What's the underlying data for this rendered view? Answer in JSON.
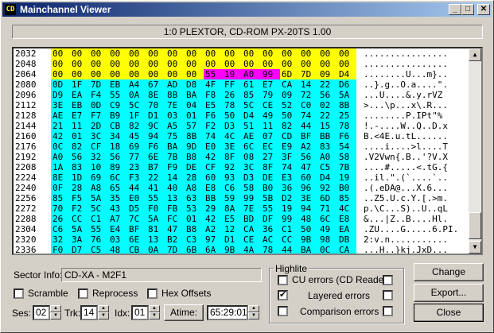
{
  "window": {
    "title": "Mainchannel Viewer",
    "icon_text": "CD",
    "min": "_",
    "max": "□",
    "close": "✕"
  },
  "drive": "1:0 PLEXTOR, CD-ROM PX-20TS 1.00",
  "hex_rows": [
    {
      "addr": "2032",
      "bytes": [
        "00",
        "00",
        "00",
        "00",
        "00",
        "00",
        "00",
        "00",
        "00",
        "00",
        "00",
        "00",
        "00",
        "00",
        "00",
        "00"
      ],
      "hl": [
        "y",
        "y",
        "y",
        "y",
        "y",
        "y",
        "y",
        "y",
        "y",
        "y",
        "y",
        "y",
        "y",
        "y",
        "y",
        "y"
      ],
      "ascii": "................"
    },
    {
      "addr": "2048",
      "bytes": [
        "00",
        "00",
        "00",
        "00",
        "00",
        "00",
        "00",
        "00",
        "00",
        "00",
        "00",
        "00",
        "00",
        "00",
        "00",
        "00"
      ],
      "hl": [
        "y",
        "y",
        "y",
        "y",
        "y",
        "y",
        "y",
        "y",
        "y",
        "y",
        "y",
        "y",
        "y",
        "y",
        "y",
        "y"
      ],
      "ascii": "................"
    },
    {
      "addr": "2064",
      "bytes": [
        "00",
        "00",
        "00",
        "00",
        "00",
        "00",
        "00",
        "00",
        "55",
        "19",
        "A0",
        "99",
        "6D",
        "7D",
        "09",
        "D4"
      ],
      "hl": [
        "y",
        "y",
        "y",
        "y",
        "y",
        "y",
        "y",
        "y",
        "m",
        "m",
        "m",
        "m",
        "y",
        "y",
        "y",
        "y"
      ],
      "ascii": "........U...m}.."
    },
    {
      "addr": "2080",
      "bytes": [
        "0D",
        "1F",
        "7D",
        "EB",
        "A4",
        "67",
        "AD",
        "D8",
        "4F",
        "FF",
        "61",
        "E7",
        "CA",
        "14",
        "22",
        "D6"
      ],
      "hl": [
        "c",
        "c",
        "c",
        "c",
        "c",
        "c",
        "c",
        "c",
        "c",
        "c",
        "c",
        "c",
        "c",
        "c",
        "c",
        "c"
      ],
      "ascii": "..}.g..O.a....\"."
    },
    {
      "addr": "2096",
      "bytes": [
        "D9",
        "EA",
        "F4",
        "55",
        "0A",
        "8E",
        "8B",
        "BA",
        "F8",
        "26",
        "85",
        "79",
        "09",
        "72",
        "56",
        "5A"
      ],
      "hl": [
        "c",
        "c",
        "c",
        "c",
        "c",
        "c",
        "c",
        "c",
        "c",
        "c",
        "c",
        "c",
        "c",
        "c",
        "c",
        "c"
      ],
      "ascii": "...U....&.y.rVZ"
    },
    {
      "addr": "2112",
      "bytes": [
        "3E",
        "EB",
        "0D",
        "C9",
        "5C",
        "70",
        "7E",
        "04",
        "E5",
        "78",
        "5C",
        "CE",
        "52",
        "C0",
        "02",
        "8B"
      ],
      "hl": [
        "c",
        "c",
        "c",
        "c",
        "c",
        "c",
        "c",
        "c",
        "c",
        "c",
        "c",
        "c",
        "c",
        "c",
        "c",
        "c"
      ],
      "ascii": ">...\\p...x\\.R..."
    },
    {
      "addr": "2128",
      "bytes": [
        "AE",
        "E7",
        "F7",
        "B9",
        "1F",
        "D1",
        "03",
        "01",
        "F6",
        "50",
        "D4",
        "49",
        "50",
        "74",
        "22",
        "25"
      ],
      "hl": [
        "c",
        "c",
        "c",
        "c",
        "c",
        "c",
        "c",
        "c",
        "c",
        "c",
        "c",
        "c",
        "c",
        "c",
        "c",
        "c"
      ],
      "ascii": "........P.IPt\"%"
    },
    {
      "addr": "2144",
      "bytes": [
        "21",
        "11",
        "2D",
        "CB",
        "82",
        "9C",
        "A5",
        "57",
        "F2",
        "D3",
        "51",
        "11",
        "82",
        "44",
        "15",
        "78"
      ],
      "hl": [
        "c",
        "c",
        "c",
        "c",
        "c",
        "c",
        "c",
        "c",
        "c",
        "c",
        "c",
        "c",
        "c",
        "c",
        "c",
        "c"
      ],
      "ascii": "!.-....W..Q..D.x"
    },
    {
      "addr": "2160",
      "bytes": [
        "42",
        "01",
        "3C",
        "34",
        "45",
        "94",
        "75",
        "8B",
        "74",
        "4C",
        "AE",
        "07",
        "CD",
        "BF",
        "BB",
        "F6"
      ],
      "hl": [
        "c",
        "c",
        "c",
        "c",
        "c",
        "c",
        "c",
        "c",
        "c",
        "c",
        "c",
        "c",
        "c",
        "c",
        "c",
        "c"
      ],
      "ascii": "B.<4E.u.tL......"
    },
    {
      "addr": "2176",
      "bytes": [
        "0C",
        "82",
        "CF",
        "18",
        "69",
        "F6",
        "BA",
        "9D",
        "E0",
        "3E",
        "6C",
        "EC",
        "E9",
        "A2",
        "83",
        "54"
      ],
      "hl": [
        "c",
        "c",
        "c",
        "c",
        "c",
        "c",
        "c",
        "c",
        "c",
        "c",
        "c",
        "c",
        "c",
        "c",
        "c",
        "c"
      ],
      "ascii": "....i....>l....T"
    },
    {
      "addr": "2192",
      "bytes": [
        "A0",
        "56",
        "32",
        "56",
        "77",
        "6E",
        "7B",
        "B8",
        "42",
        "8F",
        "08",
        "27",
        "3F",
        "56",
        "A0",
        "58"
      ],
      "hl": [
        "c",
        "c",
        "c",
        "c",
        "c",
        "c",
        "c",
        "c",
        "c",
        "c",
        "c",
        "c",
        "c",
        "c",
        "c",
        "c"
      ],
      "ascii": ".V2Vwn{.B..'?V.X"
    },
    {
      "addr": "2208",
      "bytes": [
        "1A",
        "83",
        "10",
        "89",
        "23",
        "B7",
        "F9",
        "DE",
        "CF",
        "92",
        "3C",
        "8F",
        "74",
        "47",
        "C5",
        "7B"
      ],
      "hl": [
        "c",
        "c",
        "c",
        "c",
        "c",
        "c",
        "c",
        "c",
        "c",
        "c",
        "c",
        "c",
        "c",
        "c",
        "c",
        "c"
      ],
      "ascii": "....#.....<.tG.{"
    },
    {
      "addr": "2224",
      "bytes": [
        "8E",
        "1D",
        "69",
        "6C",
        "F3",
        "22",
        "14",
        "28",
        "60",
        "93",
        "D3",
        "DE",
        "E3",
        "60",
        "D4",
        "19"
      ],
      "hl": [
        "c",
        "c",
        "c",
        "c",
        "c",
        "c",
        "c",
        "c",
        "c",
        "c",
        "c",
        "c",
        "c",
        "c",
        "c",
        "c"
      ],
      "ascii": "..il.\".(`....`.."
    },
    {
      "addr": "2240",
      "bytes": [
        "0F",
        "28",
        "A8",
        "65",
        "44",
        "41",
        "40",
        "A8",
        "E8",
        "C6",
        "58",
        "B0",
        "36",
        "96",
        "92",
        "B0"
      ],
      "hl": [
        "c",
        "c",
        "c",
        "c",
        "c",
        "c",
        "c",
        "c",
        "c",
        "c",
        "c",
        "c",
        "c",
        "c",
        "c",
        "c"
      ],
      "ascii": ".(.eDA@...X.6..."
    },
    {
      "addr": "2256",
      "bytes": [
        "85",
        "F5",
        "5A",
        "35",
        "E0",
        "55",
        "13",
        "63",
        "BB",
        "59",
        "99",
        "5B",
        "D2",
        "3E",
        "6D",
        "85"
      ],
      "hl": [
        "c",
        "c",
        "c",
        "c",
        "c",
        "c",
        "c",
        "c",
        "c",
        "c",
        "c",
        "c",
        "c",
        "c",
        "c",
        "c"
      ],
      "ascii": "..Z5.U.c.Y.[.>m."
    },
    {
      "addr": "2272",
      "bytes": [
        "70",
        "F2",
        "5C",
        "43",
        "D5",
        "F0",
        "FB",
        "53",
        "29",
        "8A",
        "7E",
        "55",
        "19",
        "94",
        "71",
        "4C"
      ],
      "hl": [
        "c",
        "c",
        "c",
        "c",
        "c",
        "c",
        "c",
        "c",
        "c",
        "c",
        "c",
        "c",
        "c",
        "c",
        "c",
        "c"
      ],
      "ascii": "p.\\C...S)..U..qL"
    },
    {
      "addr": "2288",
      "bytes": [
        "26",
        "CC",
        "C1",
        "A7",
        "7C",
        "5A",
        "FC",
        "01",
        "42",
        "E5",
        "BD",
        "DF",
        "99",
        "48",
        "6C",
        "E8"
      ],
      "hl": [
        "c",
        "c",
        "c",
        "c",
        "c",
        "c",
        "c",
        "c",
        "c",
        "c",
        "c",
        "c",
        "c",
        "c",
        "c",
        "c"
      ],
      "ascii": "&...|Z..B....Hl."
    },
    {
      "addr": "2304",
      "bytes": [
        "C6",
        "5A",
        "55",
        "E4",
        "BF",
        "81",
        "47",
        "B8",
        "A2",
        "12",
        "CA",
        "36",
        "C1",
        "50",
        "49",
        "EA"
      ],
      "hl": [
        "c",
        "c",
        "c",
        "c",
        "c",
        "c",
        "c",
        "c",
        "c",
        "c",
        "c",
        "c",
        "c",
        "c",
        "c",
        "c"
      ],
      "ascii": ".ZU....G.....6.PI."
    },
    {
      "addr": "2320",
      "bytes": [
        "32",
        "3A",
        "76",
        "03",
        "6E",
        "13",
        "B2",
        "C3",
        "97",
        "D1",
        "CE",
        "AC",
        "CC",
        "9B",
        "98",
        "DB"
      ],
      "hl": [
        "c",
        "c",
        "c",
        "c",
        "c",
        "c",
        "c",
        "c",
        "c",
        "c",
        "c",
        "c",
        "c",
        "c",
        "c",
        "c"
      ],
      "ascii": "2:v.n..........."
    },
    {
      "addr": "2336",
      "bytes": [
        "F0",
        "D7",
        "C5",
        "48",
        "CB",
        "0A",
        "7D",
        "6B",
        "6A",
        "9B",
        "4A",
        "78",
        "44",
        "BA",
        "0C",
        "CA"
      ],
      "hl": [
        "c",
        "c",
        "c",
        "c",
        "c",
        "c",
        "c",
        "c",
        "c",
        "c",
        "c",
        "c",
        "c",
        "c",
        "c",
        "c"
      ],
      "ascii": "...H..}kj.JxD..."
    }
  ],
  "sector_info": {
    "label": "Sector Info:",
    "value": "CD-XA - M2F1"
  },
  "options": {
    "scramble": "Scramble",
    "reprocess": "Reprocess",
    "hex_offsets": "Hex Offsets"
  },
  "position": {
    "ses_label": "Ses:",
    "ses_value": "02",
    "trk_label": "Trk:",
    "trk_value": "14",
    "idx_label": "Idx:",
    "idx_value": "01",
    "atime_label": "Atime:",
    "atime_value": "65:29:01"
  },
  "highlite": {
    "title": "Highlite",
    "cu_errors": "CU errors (CD Reader)",
    "layered_errors": "Layered errors",
    "comparison_errors": "Comparison errors",
    "layered_checkmark": "✔"
  },
  "buttons": {
    "change_colors": "Change Colors...",
    "export": "Export...",
    "close": "Close"
  }
}
